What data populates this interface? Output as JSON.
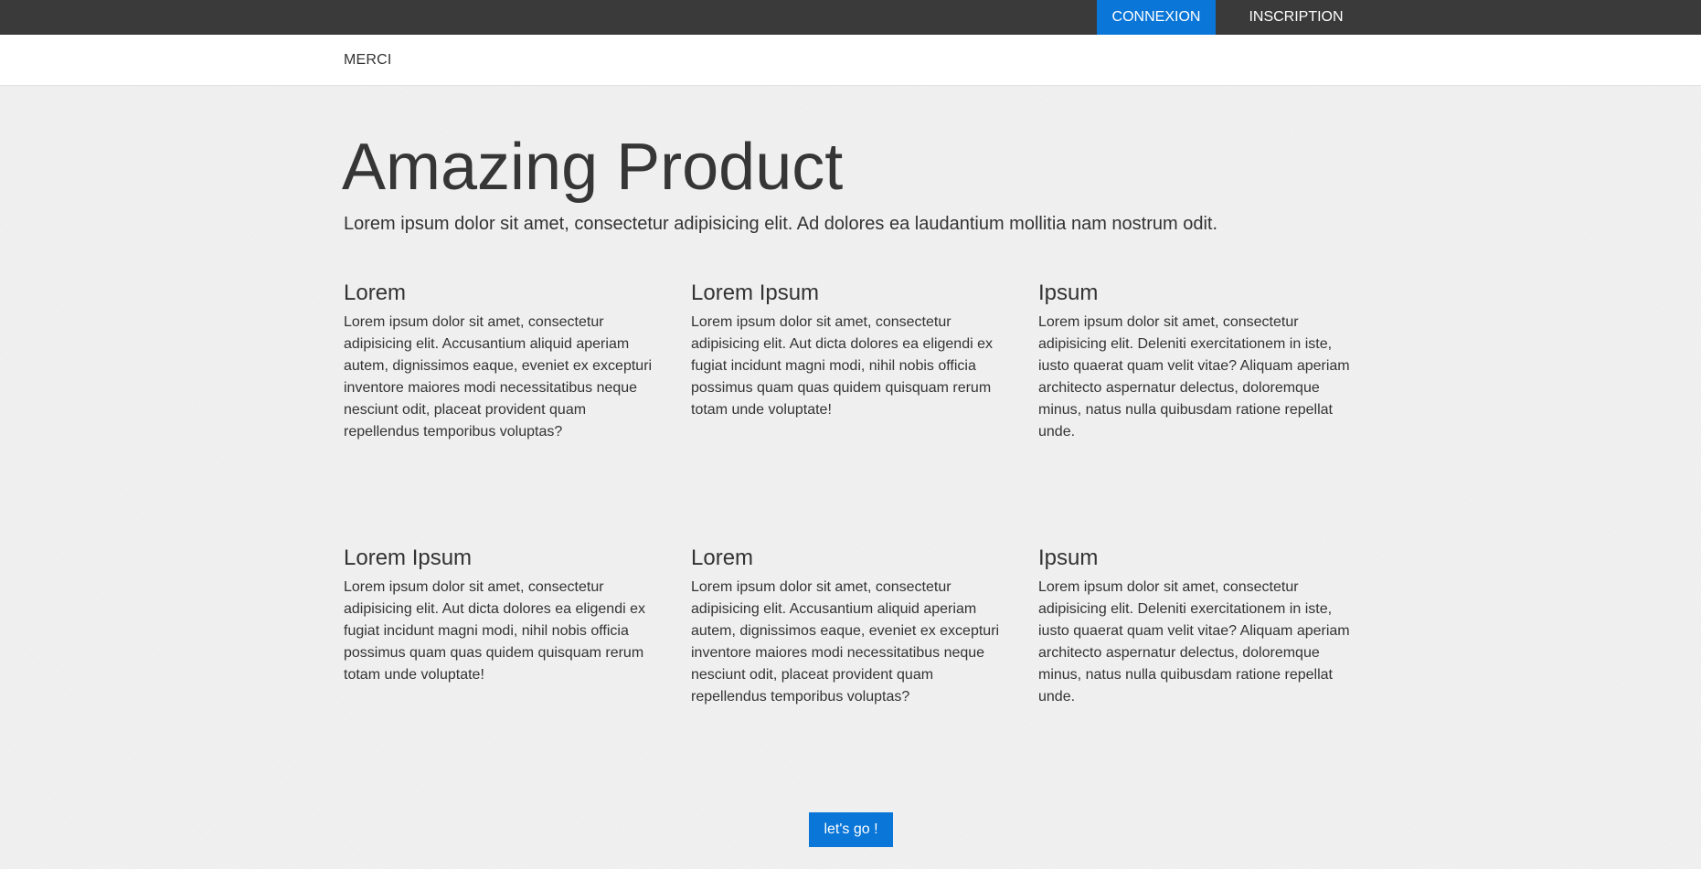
{
  "topnav": {
    "connexion": "CONNEXION",
    "inscription": "INSCRIPTION",
    "active_color": "#0a76d8",
    "bar_color": "#3a3a3a"
  },
  "subnav": {
    "brand": "MERCI"
  },
  "hero": {
    "title": "Amazing Product",
    "lead": "Lorem ipsum dolor sit amet, consectetur adipisicing elit. Ad dolores ea laudantium mollitia nam nostrum odit."
  },
  "features": [
    {
      "title": "Lorem",
      "text": "Lorem ipsum dolor sit amet, consectetur adipisicing elit. Accusantium aliquid aperiam autem, dignissimos eaque, eveniet ex excepturi inventore maiores modi necessitatibus neque nesciunt odit, placeat provident quam repellendus temporibus voluptas?"
    },
    {
      "title": "Lorem Ipsum",
      "text": "Lorem ipsum dolor sit amet, consectetur adipisicing elit. Aut dicta dolores ea eligendi ex fugiat incidunt magni modi, nihil nobis officia possimus quam quas quidem quisquam rerum totam unde voluptate!"
    },
    {
      "title": "Ipsum",
      "text": "Lorem ipsum dolor sit amet, consectetur adipisicing elit. Deleniti exercitationem in iste, iusto quaerat quam velit vitae? Aliquam aperiam architecto aspernatur delectus, doloremque minus, natus nulla quibusdam ratione repellat unde."
    },
    {
      "title": "Lorem Ipsum",
      "text": "Lorem ipsum dolor sit amet, consectetur adipisicing elit. Aut dicta dolores ea eligendi ex fugiat incidunt magni modi, nihil nobis officia possimus quam quas quidem quisquam rerum totam unde voluptate!"
    },
    {
      "title": "Lorem",
      "text": "Lorem ipsum dolor sit amet, consectetur adipisicing elit. Accusantium aliquid aperiam autem, dignissimos eaque, eveniet ex excepturi inventore maiores modi necessitatibus neque nesciunt odit, placeat provident quam repellendus temporibus voluptas?"
    },
    {
      "title": "Ipsum",
      "text": "Lorem ipsum dolor sit amet, consectetur adipisicing elit. Deleniti exercitationem in iste, iusto quaerat quam velit vitae? Aliquam aperiam architecto aspernatur delectus, doloremque minus, natus nulla quibusdam ratione repellat unde."
    }
  ],
  "cta": {
    "label": "let's go !"
  }
}
